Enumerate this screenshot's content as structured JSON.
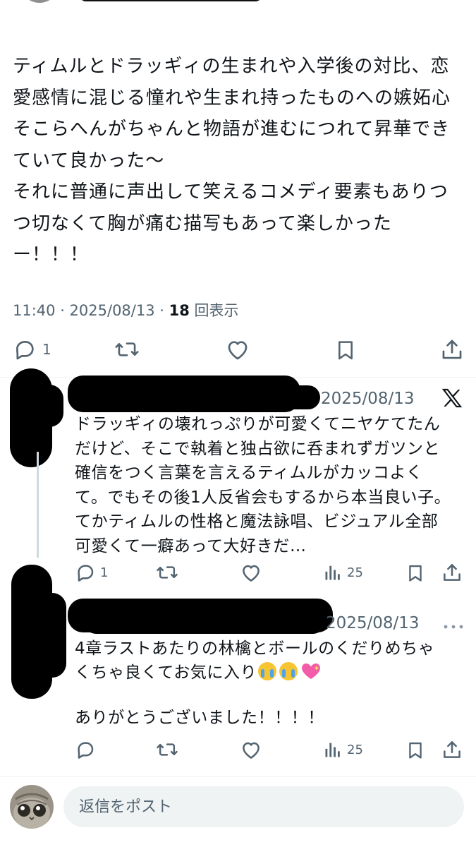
{
  "tweet": {
    "text": "ティムルとドラッギィの生まれや入学後の対比、恋\n愛感情に混じる憧れや生まれ持ったものへの嫉妬心\nそこらへんがちゃんと物語が進むにつれて昇華でき\nていて良かった〜\nそれに普通に声出して笑えるコメディ要素もありつ\nつ切なくて胸が痛む描写もあって楽しかった\nー！！！",
    "time": "11:40 · 2025/08/13 · ",
    "views": "18",
    "views_label": " 回表示",
    "reply_count": "1",
    "icons": [
      "reply-icon",
      "retweet-icon",
      "like-icon",
      "bookmark-icon",
      "share-icon"
    ]
  },
  "replies": [
    {
      "date": "2025/08/13",
      "text": "ドラッギィの壊れっぷりが可愛くてニヤケてたん\nだけど、そこで執着と独占欲に呑まれずガツンと\n確信をつく言葉を言えるティムルがカッコよく\nて。でもその後1人反省会もするから本当良い子。\nてかティムルの性格と魔法詠唱、ビジュアル全部\n可愛くて一癖あって大好きだ…",
      "reply_count": "1",
      "views": "25",
      "badge_icon": "x-logo-icon"
    },
    {
      "date": "2025/08/13",
      "text_line1": "4章ラストあたりの林檎とボールのくだりめちゃ",
      "text_line2": "くちゃ良くてお気に入り",
      "emojis": [
        "loudly-crying-face",
        "loudly-crying-face",
        "sparkling-heart"
      ],
      "text_line3": "ありがとうございました！！！！",
      "views": "25",
      "more_icon": "more-icon"
    }
  ],
  "compose": {
    "placeholder": "返信をポスト"
  },
  "colors": {
    "text": "#0f1419",
    "secondary": "#536471",
    "reply_box": "#eff3f4",
    "divider": "#eff3f4"
  }
}
